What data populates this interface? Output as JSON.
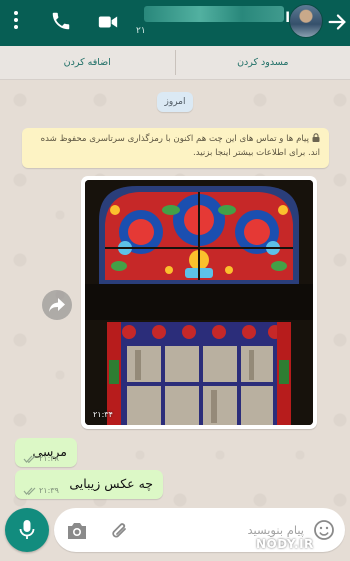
{
  "header": {
    "subtitle": "۲۱",
    "name_fragment": "ا",
    "icons": [
      "menu-dots-icon",
      "phone-icon",
      "video-icon",
      "back-arrow-icon"
    ],
    "color": "#075e54"
  },
  "actions": {
    "add_label": "اضافه کردن",
    "block_label": "مسدود کردن"
  },
  "chat": {
    "date_label": "امروز",
    "encryption_notice": "پیام ها و تماس های این چت هم اکنون با رمزگذاری سرتاسری محفوظ شده اند. برای اطلاعات بیشتر اینجا بزنید.",
    "image_message": {
      "time": "۲۱:۳۴"
    },
    "messages": [
      {
        "text": "مرسی",
        "time": "۲۱:۳۸"
      },
      {
        "text": "چه عکس زیبایی",
        "time": "۲۱:۳۹"
      }
    ],
    "outgoing_bubble_color": "#dcf8c6"
  },
  "composer": {
    "placeholder": "پیام بنویسید",
    "icons": [
      "mic-icon",
      "camera-icon",
      "attach-icon",
      "emoji-icon"
    ]
  },
  "watermark": "NODY.IR"
}
